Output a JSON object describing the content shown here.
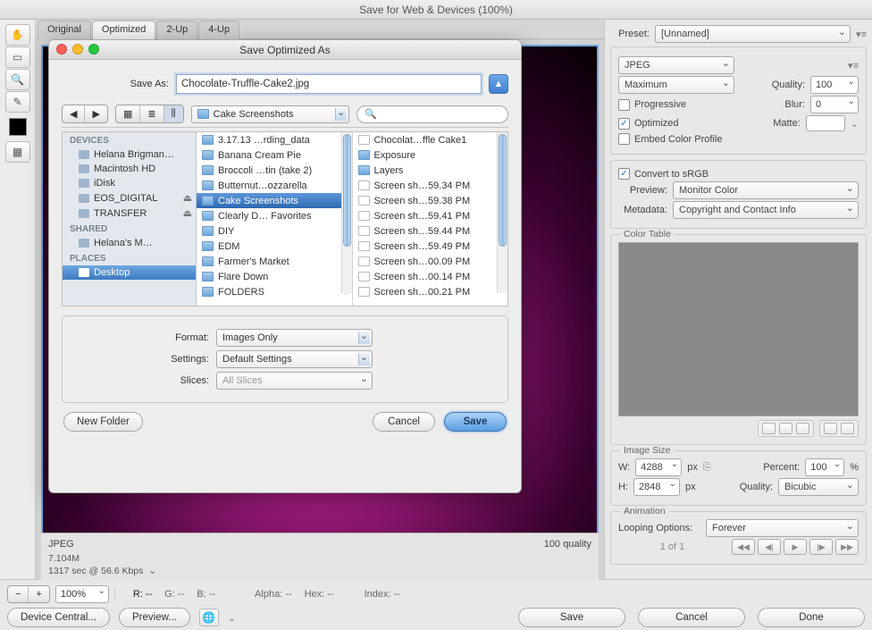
{
  "window": {
    "title": "Save for Web & Devices (100%)"
  },
  "tabs": [
    "Original",
    "Optimized",
    "2-Up",
    "4-Up"
  ],
  "active_tab": 1,
  "status": {
    "format": "JPEG",
    "size": "7.104M",
    "time": "1317 sec @ 56.6 Kbps",
    "quality": "100 quality"
  },
  "footer": {
    "zoom": "100%",
    "readouts": {
      "r": "R: --",
      "g": "G: --",
      "b": "B: --",
      "alpha": "Alpha: --",
      "hex": "Hex: --",
      "index": "Index: --"
    },
    "buttons": {
      "device": "Device Central...",
      "preview": "Preview...",
      "cancel": "Cancel",
      "save": "Save",
      "done": "Done"
    }
  },
  "preset_panel": {
    "preset_label": "Preset:",
    "preset": "[Unnamed]",
    "format": "JPEG",
    "quality_sel": "Maximum",
    "quality_label": "Quality:",
    "quality_val": "100",
    "progressive": "Progressive",
    "blur_label": "Blur:",
    "blur_val": "0",
    "optimized": "Optimized",
    "matte_label": "Matte:",
    "embed": "Embed Color Profile"
  },
  "convert_panel": {
    "srgb": "Convert to sRGB",
    "preview_label": "Preview:",
    "preview": "Monitor Color",
    "meta_label": "Metadata:",
    "meta": "Copyright and Contact Info"
  },
  "colortable_title": "Color Table",
  "imagesize": {
    "title": "Image Size",
    "w_label": "W:",
    "w": "4288",
    "h_label": "H:",
    "h": "2848",
    "px": "px",
    "percent_label": "Percent:",
    "percent": "100",
    "pct": "%",
    "quality_label": "Quality:",
    "quality": "Bicubic"
  },
  "animation": {
    "title": "Animation",
    "loop_label": "Looping Options:",
    "loop": "Forever",
    "frame": "1 of 1"
  },
  "dialog": {
    "title": "Save Optimized As",
    "saveas_label": "Save As:",
    "filename": "Chocolate-Truffle-Cake2.jpg",
    "location": "Cake Screenshots",
    "sidebar": {
      "devices": "DEVICES",
      "devices_items": [
        "Helana Brigman…",
        "Macintosh HD",
        "iDisk",
        "EOS_DIGITAL",
        "TRANSFER"
      ],
      "shared": "SHARED",
      "shared_items": [
        "Helana's M…"
      ],
      "places": "PLACES",
      "places_items": [
        "Desktop"
      ]
    },
    "col1": [
      "3.17.13 …rding_data",
      "Banana Cream Pie",
      "Broccoli …tin (take 2)",
      "Butternut…ozzarella",
      "Cake Screenshots",
      "Clearly D… Favorites",
      "DIY",
      "EDM",
      "Farmer's Market",
      "Flare Down",
      "FOLDERS"
    ],
    "col1_selected": 4,
    "col2": [
      {
        "name": "Chocolat…ffle Cake1",
        "folder": false
      },
      {
        "name": "Exposure",
        "folder": true
      },
      {
        "name": "Layers",
        "folder": true
      },
      {
        "name": "Screen sh…59.34 PM",
        "folder": false
      },
      {
        "name": "Screen sh…59.38 PM",
        "folder": false
      },
      {
        "name": "Screen sh…59.41 PM",
        "folder": false
      },
      {
        "name": "Screen sh…59.44 PM",
        "folder": false
      },
      {
        "name": "Screen sh…59.49 PM",
        "folder": false
      },
      {
        "name": "Screen sh…00.09 PM",
        "folder": false
      },
      {
        "name": "Screen sh…00.14 PM",
        "folder": false
      },
      {
        "name": "Screen sh…00.21 PM",
        "folder": false
      }
    ],
    "format_label": "Format:",
    "format": "Images Only",
    "settings_label": "Settings:",
    "settings": "Default Settings",
    "slices_label": "Slices:",
    "slices": "All Slices",
    "newfolder": "New Folder",
    "cancel": "Cancel",
    "save": "Save"
  }
}
